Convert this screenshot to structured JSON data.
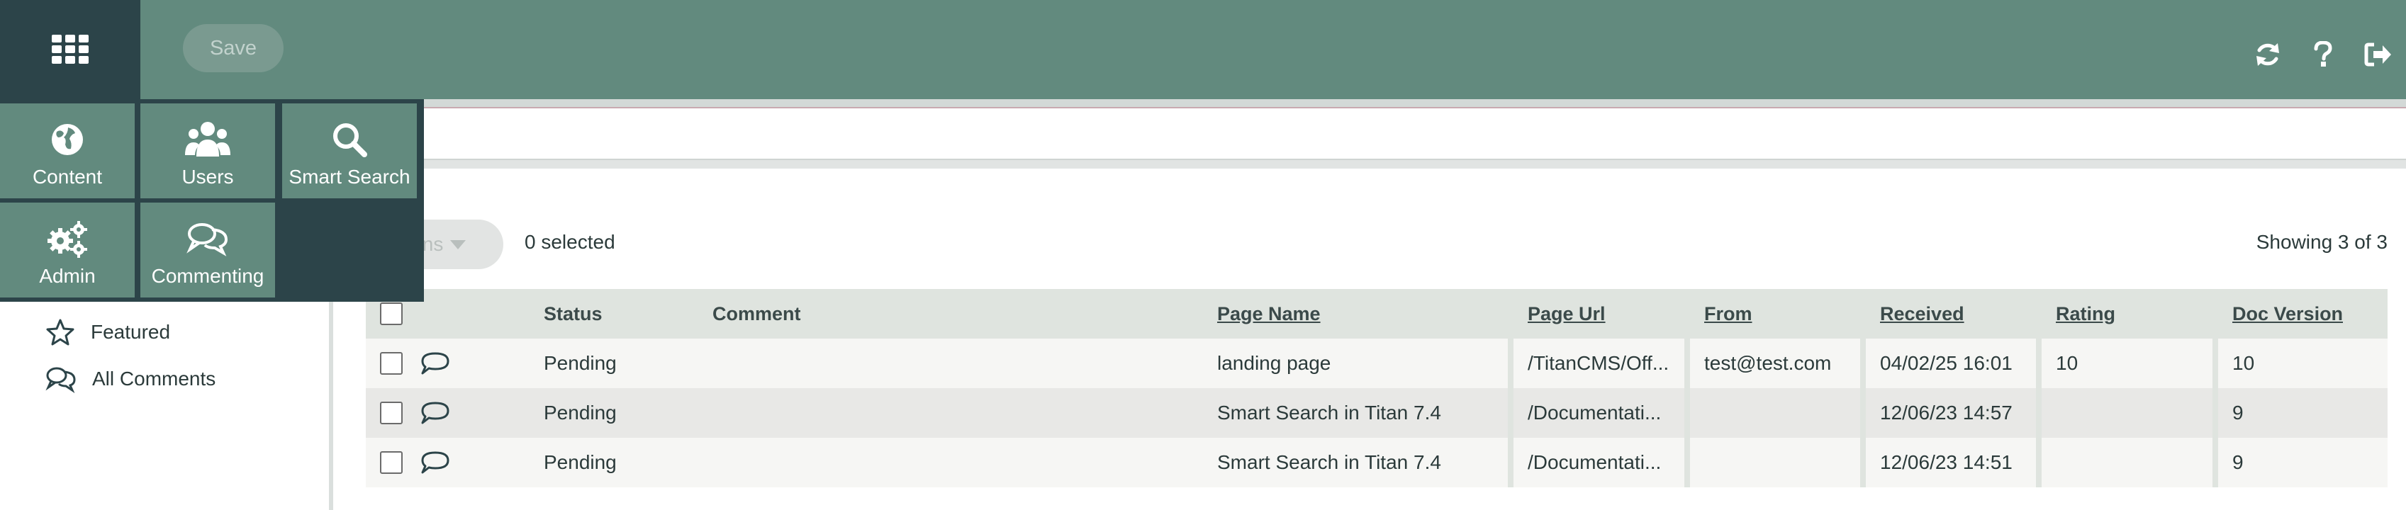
{
  "topbar": {
    "save_label": "Save",
    "icons": [
      "apps-grid-icon",
      "refresh-icon",
      "help-icon",
      "sign-out-icon"
    ]
  },
  "app_menu": {
    "tiles": [
      {
        "label": "Content",
        "icon": "globe-icon"
      },
      {
        "label": "Users",
        "icon": "users-icon"
      },
      {
        "label": "Smart Search",
        "icon": "search-icon"
      },
      {
        "label": "Admin",
        "icon": "gears-icon"
      },
      {
        "label": "Commenting",
        "icon": "comments-icon"
      }
    ]
  },
  "sidebar": {
    "items": [
      {
        "label": "Featured",
        "icon": "star-icon"
      },
      {
        "label": "All Comments",
        "icon": "comments-icon"
      }
    ]
  },
  "toolbar": {
    "actions_label_fragment": "ions",
    "selected_text": "0 selected",
    "showing_text": "Showing 3 of 3"
  },
  "table": {
    "headers": {
      "status": "Status",
      "comment": "Comment",
      "page_name": "Page Name",
      "page_url": "Page Url",
      "from": "From",
      "received": "Received",
      "rating": "Rating",
      "doc_version": "Doc Version"
    },
    "rows": [
      {
        "status": "Pending",
        "comment": "",
        "page_name": "landing page",
        "page_url": "/TitanCMS/Off...",
        "from": "test@test.com",
        "received": "04/02/25 16:01",
        "rating": "10",
        "doc_version": "10"
      },
      {
        "status": "Pending",
        "comment": "",
        "page_name": "Smart Search in Titan 7.4",
        "page_url": "/Documentati...",
        "from": "",
        "received": "12/06/23 14:57",
        "rating": "",
        "doc_version": "9"
      },
      {
        "status": "Pending",
        "comment": "",
        "page_name": "Smart Search in Titan 7.4",
        "page_url": "/Documentati...",
        "from": "",
        "received": "12/06/23 14:51",
        "rating": "",
        "doc_version": "9"
      }
    ]
  },
  "colors": {
    "topbar": "#628a7e",
    "dark": "#2c4449",
    "tile": "#628a7e",
    "header_row": "#dfe4df"
  }
}
